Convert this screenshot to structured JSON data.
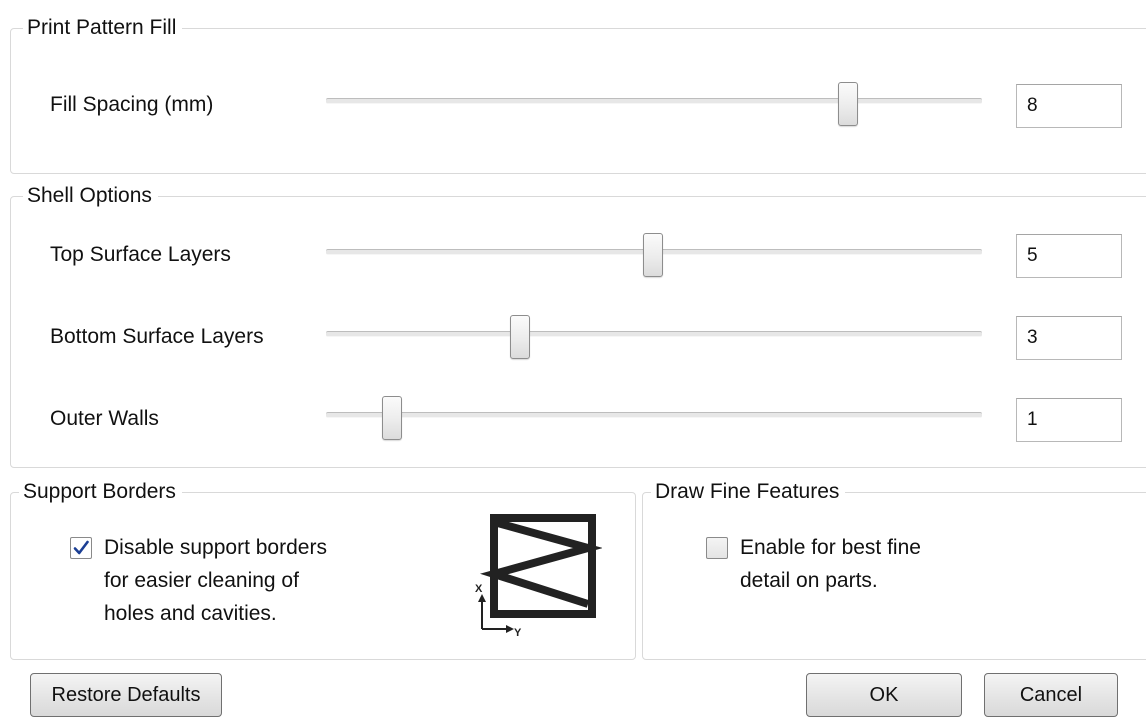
{
  "print_pattern_fill": {
    "title": "Print Pattern Fill",
    "fill_spacing": {
      "label": "Fill Spacing (mm)",
      "value": "8",
      "slider_fraction": 0.793
    }
  },
  "shell_options": {
    "title": "Shell Options",
    "top_surface_layers": {
      "label": "Top Surface Layers",
      "value": "5",
      "slider_fraction": 0.498
    },
    "bottom_surface_layers": {
      "label": "Bottom Surface Layers",
      "value": "3",
      "slider_fraction": 0.293
    },
    "outer_walls": {
      "label": "Outer Walls",
      "value": "1",
      "slider_fraction": 0.097
    }
  },
  "support_borders": {
    "title": "Support Borders",
    "checkbox_checked": true,
    "checkbox_lines": [
      "Disable support borders",
      "for easier cleaning of",
      "holes and cavities."
    ],
    "axis_x": "X",
    "axis_y": "Y"
  },
  "draw_fine_features": {
    "title": "Draw Fine Features",
    "checkbox_checked": false,
    "checkbox_lines": [
      "Enable for best fine",
      "detail on parts."
    ]
  },
  "buttons": {
    "restore_defaults": "Restore Defaults",
    "ok": "OK",
    "cancel": "Cancel"
  }
}
